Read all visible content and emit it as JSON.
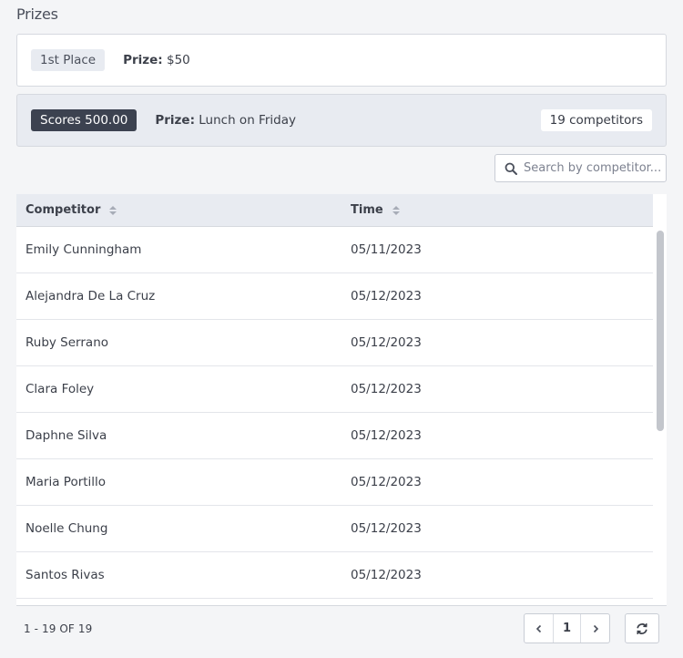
{
  "page": {
    "title": "Prizes"
  },
  "prizes": [
    {
      "badge": "1st Place",
      "prize_label": "Prize:",
      "prize_value": "$50"
    },
    {
      "badge": "Scores 500.00",
      "prize_label": "Prize:",
      "prize_value": "Lunch on Friday",
      "competitors": "19 competitors"
    }
  ],
  "search": {
    "placeholder": "Search by competitor..."
  },
  "table": {
    "columns": [
      "Competitor",
      "Time"
    ],
    "rows": [
      {
        "competitor": "Emily Cunningham",
        "time": "05/11/2023"
      },
      {
        "competitor": "Alejandra De La Cruz",
        "time": "05/12/2023"
      },
      {
        "competitor": "Ruby Serrano",
        "time": "05/12/2023"
      },
      {
        "competitor": "Clara Foley",
        "time": "05/12/2023"
      },
      {
        "competitor": "Daphne Silva",
        "time": "05/12/2023"
      },
      {
        "competitor": "Maria Portillo",
        "time": "05/12/2023"
      },
      {
        "competitor": "Noelle Chung",
        "time": "05/12/2023"
      },
      {
        "competitor": "Santos Rivas",
        "time": "05/12/2023"
      }
    ]
  },
  "footer": {
    "range": "1 - 19 OF 19",
    "prev": "‹",
    "page": "1",
    "next": "›"
  },
  "colors": {
    "dark_badge": "#3c4250",
    "light_badge": "#e8ebf1",
    "header_bg": "#e8ebf1"
  }
}
